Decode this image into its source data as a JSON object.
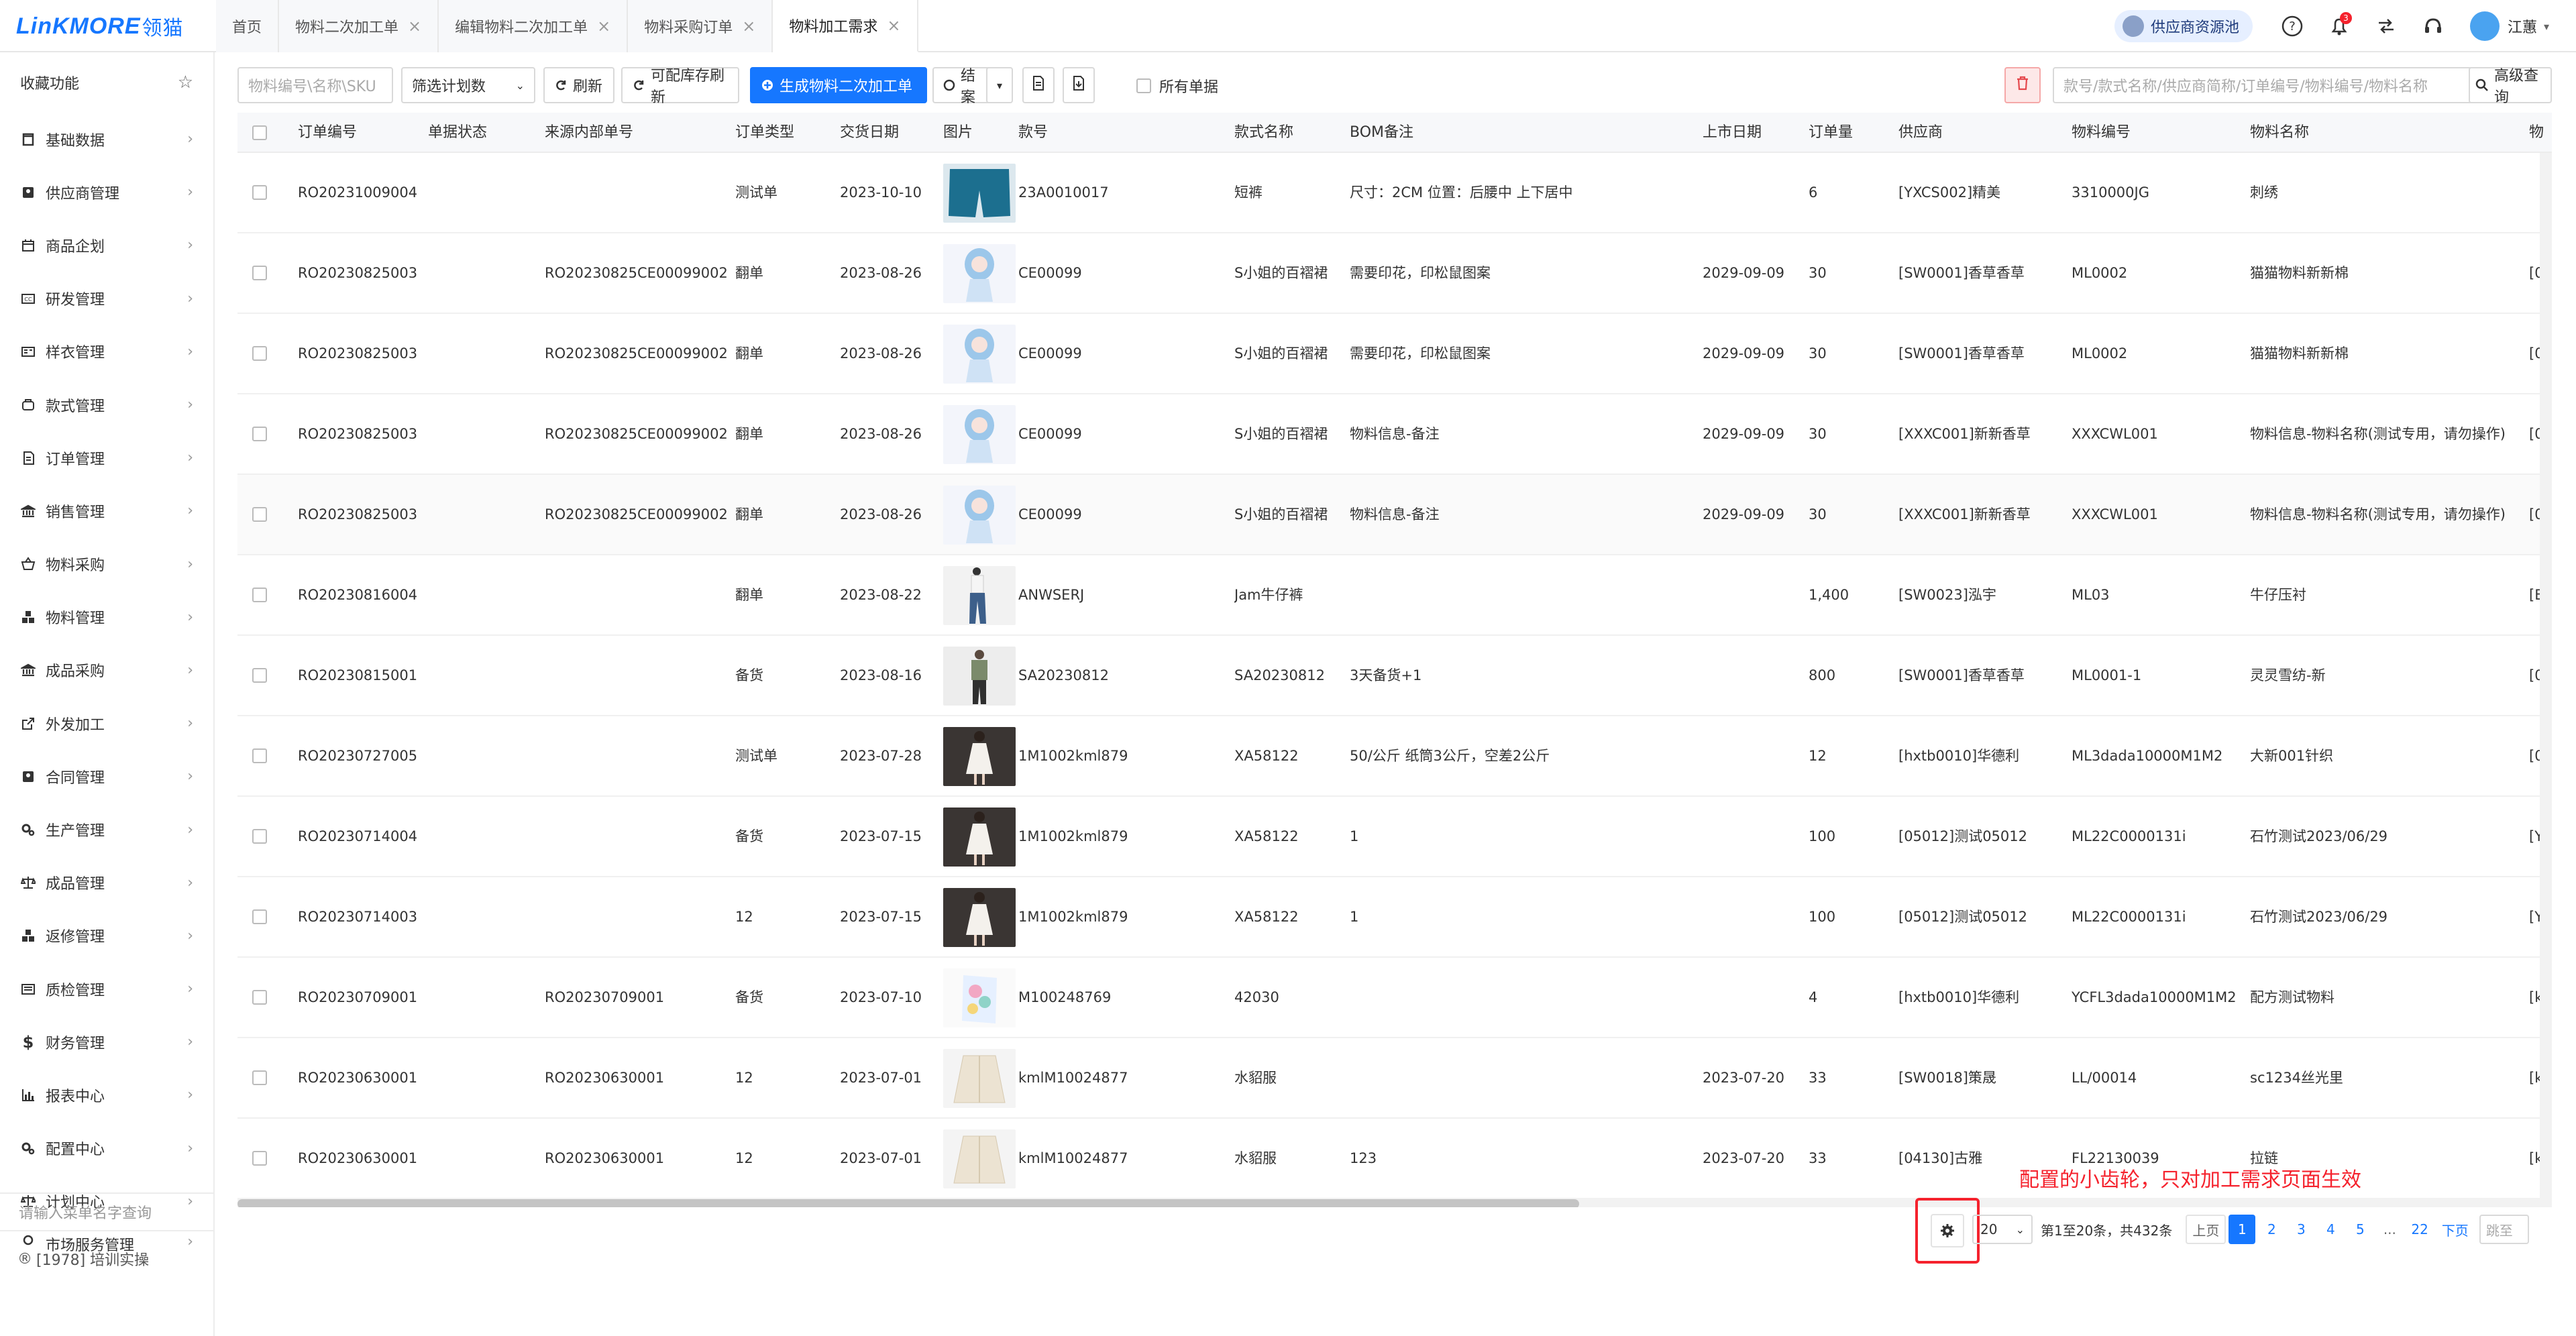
{
  "app": {
    "logo": "LinKMORE",
    "logo_cn": "领猫"
  },
  "tabs": [
    {
      "label": "首页",
      "closable": false
    },
    {
      "label": "物料二次加工单",
      "closable": true
    },
    {
      "label": "编辑物料二次加工单",
      "closable": true
    },
    {
      "label": "物料采购订单",
      "closable": true
    },
    {
      "label": "物料加工需求",
      "closable": true,
      "active": true
    }
  ],
  "header": {
    "supplier_pool": "供应商资源池",
    "notif_count": "3",
    "user_name": "江蕙"
  },
  "sidebar": {
    "favorites": "收藏功能",
    "items": [
      {
        "label": "基础数据",
        "icon": "book-icon"
      },
      {
        "label": "供应商管理",
        "icon": "supplier-icon"
      },
      {
        "label": "商品企划",
        "icon": "calendar-icon"
      },
      {
        "label": "研发管理",
        "icon": "cc-icon"
      },
      {
        "label": "样衣管理",
        "icon": "id-card-icon"
      },
      {
        "label": "款式管理",
        "icon": "style-icon"
      },
      {
        "label": "订单管理",
        "icon": "order-icon"
      },
      {
        "label": "销售管理",
        "icon": "bank-icon"
      },
      {
        "label": "物料采购",
        "icon": "basket-icon"
      },
      {
        "label": "物料管理",
        "icon": "cubes-icon"
      },
      {
        "label": "成品采购",
        "icon": "bank-icon"
      },
      {
        "label": "外发加工",
        "icon": "external-link-icon"
      },
      {
        "label": "合同管理",
        "icon": "contract-icon"
      },
      {
        "label": "生产管理",
        "icon": "cogs-icon"
      },
      {
        "label": "成品管理",
        "icon": "balance-icon"
      },
      {
        "label": "返修管理",
        "icon": "cubes-icon"
      },
      {
        "label": "质检管理",
        "icon": "checklist-icon"
      },
      {
        "label": "财务管理",
        "icon": "dollar-icon"
      },
      {
        "label": "报表中心",
        "icon": "bar-chart-icon"
      },
      {
        "label": "配置中心",
        "icon": "cogs-icon"
      },
      {
        "label": "计划中心",
        "icon": "balance-icon"
      },
      {
        "label": "市场服务管理",
        "icon": "location-icon"
      }
    ],
    "search_placeholder": "请输入菜单名字查询",
    "footer": "[1978] 培训实操"
  },
  "toolbar": {
    "sku_placeholder": "物料编号\\名称\\SKU",
    "plan_filter": "筛选计划数",
    "refresh": "刷新",
    "stock_refresh": "可配库存刷新",
    "generate": "生成物料二次加工单",
    "close": "结案",
    "all_docs": "所有单据",
    "search_placeholder": "款号/款式名称/供应商简称/订单编号/物料编号/物料名称",
    "advanced_search": "高级查询"
  },
  "table": {
    "columns": [
      "订单编号",
      "单据状态",
      "来源内部单号",
      "订单类型",
      "交货日期",
      "图片",
      "款号",
      "款式名称",
      "BOM备注",
      "上市日期",
      "订单量",
      "供应商",
      "物料编号",
      "物料名称",
      "物"
    ],
    "rows": [
      {
        "order": "RO20231009004",
        "status": "",
        "source": "",
        "type": "测试单",
        "date": "2023-10-10",
        "img": "teal-shorts",
        "style_no": "23A0010017",
        "style_name": "短裤",
        "bom": "尺寸：2CM  位置：后腰中 上下居中",
        "launch": "",
        "qty": "6",
        "supplier": "[YXCS002]精美",
        "mat_no": "3310000JG",
        "mat_name": "刺绣",
        "extra": ""
      },
      {
        "order": "RO20230825003",
        "status": "",
        "source": "RO20230825CE00099002",
        "type": "翻单",
        "date": "2023-08-26",
        "img": "anime-girl",
        "style_no": "CE00099",
        "style_name": "S小姐的百褶裙",
        "bom": "需要印花，印松鼠图案",
        "launch": "2029-09-09",
        "qty": "30",
        "supplier": "[SW0001]香草香草",
        "mat_no": "ML0002",
        "mat_name": "猫猫物料新新棉",
        "extra": "[0"
      },
      {
        "order": "RO20230825003",
        "status": "",
        "source": "RO20230825CE00099002",
        "type": "翻单",
        "date": "2023-08-26",
        "img": "anime-girl",
        "style_no": "CE00099",
        "style_name": "S小姐的百褶裙",
        "bom": "需要印花，印松鼠图案",
        "launch": "2029-09-09",
        "qty": "30",
        "supplier": "[SW0001]香草香草",
        "mat_no": "ML0002",
        "mat_name": "猫猫物料新新棉",
        "extra": "[0"
      },
      {
        "order": "RO20230825003",
        "status": "",
        "source": "RO20230825CE00099002",
        "type": "翻单",
        "date": "2023-08-26",
        "img": "anime-girl",
        "style_no": "CE00099",
        "style_name": "S小姐的百褶裙",
        "bom": "物料信息-备注",
        "launch": "2029-09-09",
        "qty": "30",
        "supplier": "[XXXC001]新新香草",
        "mat_no": "XXXCWL001",
        "mat_name": "物料信息-物料名称(测试专用，请勿操作)",
        "extra": "[0"
      },
      {
        "order": "RO20230825003",
        "status": "",
        "source": "RO20230825CE00099002",
        "type": "翻单",
        "date": "2023-08-26",
        "img": "anime-girl",
        "style_no": "CE00099",
        "style_name": "S小姐的百褶裙",
        "bom": "物料信息-备注",
        "launch": "2029-09-09",
        "qty": "30",
        "supplier": "[XXXC001]新新香草",
        "mat_no": "XXXCWL001",
        "mat_name": "物料信息-物料名称(测试专用，请勿操作)",
        "extra": "[0"
      },
      {
        "order": "RO20230816004",
        "status": "",
        "source": "",
        "type": "翻单",
        "date": "2023-08-22",
        "img": "jeans",
        "style_no": "ANWSERJ",
        "style_name": "Jam牛仔裤",
        "bom": "",
        "launch": "",
        "qty": "1,400",
        "supplier": "[SW0023]泓宇",
        "mat_no": "ML03",
        "mat_name": "牛仔压衬",
        "extra": "[E"
      },
      {
        "order": "RO20230815001",
        "status": "",
        "source": "",
        "type": "备货",
        "date": "2023-08-16",
        "img": "man-casual",
        "style_no": "SA20230812",
        "style_name": "SA20230812",
        "bom": "3天备货+1",
        "launch": "",
        "qty": "800",
        "supplier": "[SW0001]香草香草",
        "mat_no": "ML0001-1",
        "mat_name": "灵灵雪纺-新",
        "extra": "[0"
      },
      {
        "order": "RO20230727005",
        "status": "",
        "source": "",
        "type": "测试单",
        "date": "2023-07-28",
        "img": "white-dress",
        "style_no": "1M1002kml879",
        "style_name": "XA58122",
        "bom": "50/公斤  纸筒3公斤，空差2公斤",
        "launch": "",
        "qty": "12",
        "supplier": "[hxtb0010]华德利",
        "mat_no": "ML3dada10000M1M2",
        "mat_name": "大新001针织",
        "extra": "[0"
      },
      {
        "order": "RO20230714004",
        "status": "",
        "source": "",
        "type": "备货",
        "date": "2023-07-15",
        "img": "white-dress",
        "style_no": "1M1002kml879",
        "style_name": "XA58122",
        "bom": "1",
        "launch": "",
        "qty": "100",
        "supplier": "[05012]测试05012",
        "mat_no": "ML22C0000131i",
        "mat_name": "石竹测试2023/06/29",
        "extra": "[Y"
      },
      {
        "order": "RO20230714003",
        "status": "",
        "source": "",
        "type": "12",
        "date": "2023-07-15",
        "img": "white-dress",
        "style_no": "1M1002kml879",
        "style_name": "XA58122",
        "bom": "1",
        "launch": "",
        "qty": "100",
        "supplier": "[05012]测试05012",
        "mat_no": "ML22C0000131i",
        "mat_name": "石竹测试2023/06/29",
        "extra": "[Y"
      },
      {
        "order": "RO20230709001",
        "status": "",
        "source": "RO20230709001",
        "type": "备货",
        "date": "2023-07-10",
        "img": "floral",
        "style_no": "M100248769",
        "style_name": "42030",
        "bom": "",
        "launch": "",
        "qty": "4",
        "supplier": "[hxtb0010]华德利",
        "mat_no": "YCFL3dada10000M1M2",
        "mat_name": "配方测试物料",
        "extra": "[k"
      },
      {
        "order": "RO20230630001",
        "status": "",
        "source": "RO20230630001",
        "type": "12",
        "date": "2023-07-01",
        "img": "white-coat",
        "style_no": "kmlM10024877",
        "style_name": "水貂服",
        "bom": "",
        "launch": "2023-07-20",
        "qty": "33",
        "supplier": "[SW0018]策晟",
        "mat_no": "LL/00014",
        "mat_name": "sc1234丝光里",
        "extra": "[k"
      },
      {
        "order": "RO20230630001",
        "status": "",
        "source": "RO20230630001",
        "type": "12",
        "date": "2023-07-01",
        "img": "white-coat",
        "style_no": "kmlM10024877",
        "style_name": "水貂服",
        "bom": "123",
        "launch": "2023-07-20",
        "qty": "33",
        "supplier": "[04130]古雅",
        "mat_no": "FL22130039",
        "mat_name": "拉链",
        "extra": "[k"
      }
    ]
  },
  "annotation": "配置的小齿轮，只对加工需求页面生效",
  "pagination": {
    "page_size": "20",
    "summary": "第1至20条，共432条",
    "prev": "上页",
    "pages": [
      "1",
      "2",
      "3",
      "4",
      "5"
    ],
    "ellipsis": "...",
    "last": "22",
    "next": "下页",
    "jump_placeholder": "跳至",
    "current": "1"
  },
  "colors": {
    "primary": "#1677ff",
    "danger": "#f5222d"
  }
}
